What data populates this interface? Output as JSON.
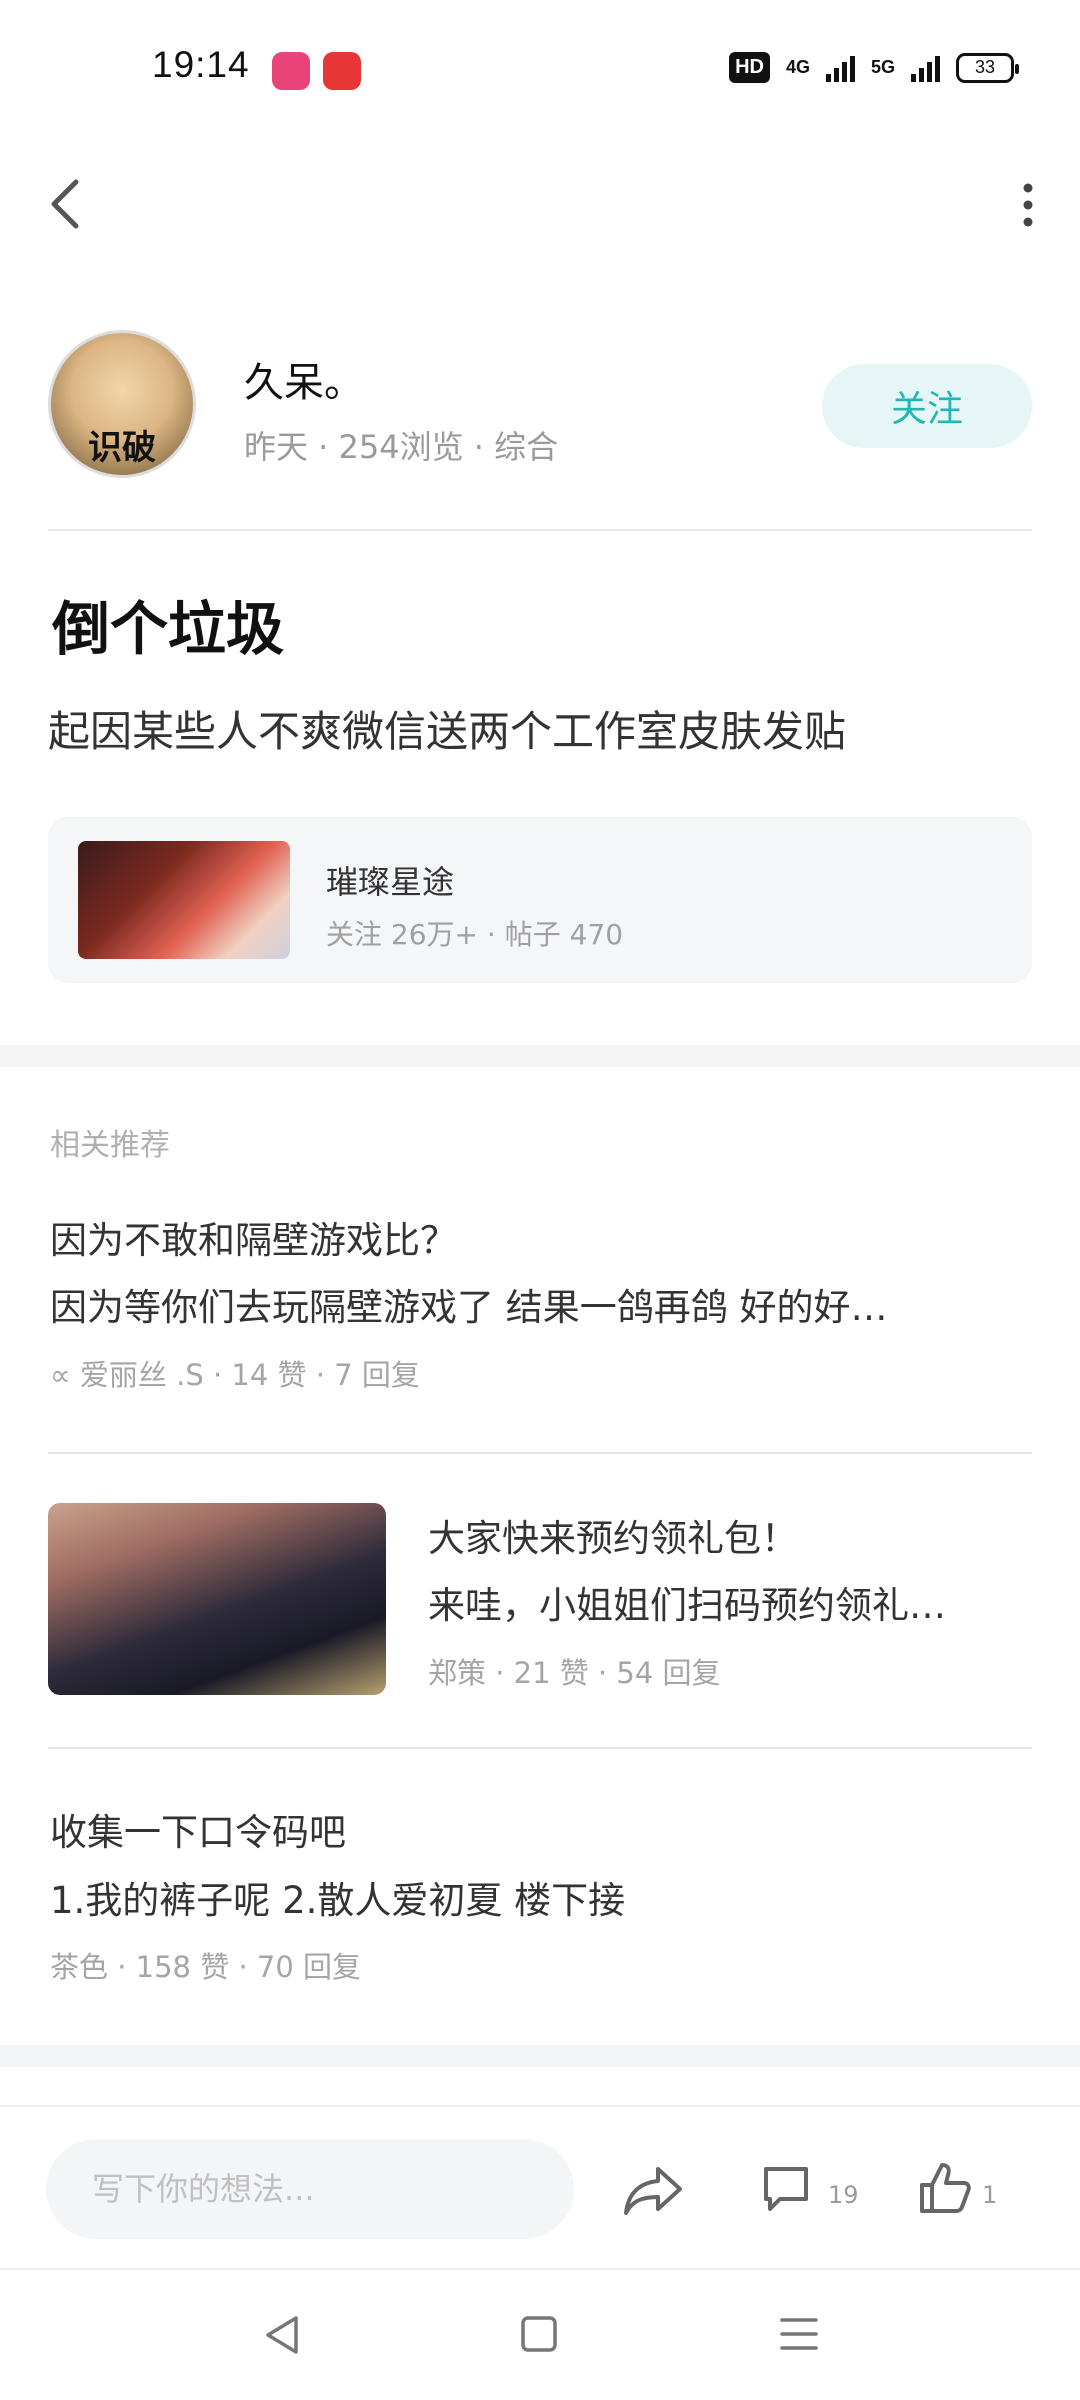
{
  "status_bar": {
    "time": "19:14",
    "hd_label": "HD",
    "net_4g": "4G",
    "net_5g": "5G",
    "battery": "33"
  },
  "author": {
    "avatar_text": "识破",
    "name": "久呆。",
    "meta": "昨天 · 254浏览 · 综合",
    "follow_label": "关注"
  },
  "post": {
    "title": "倒个垃圾",
    "body": "起因某些人不爽微信送两个工作室皮肤发贴"
  },
  "topic": {
    "name": "璀璨星途",
    "meta": "关注 26万+ · 帖子 470"
  },
  "related": {
    "header": "相关推荐",
    "items": [
      {
        "title": "因为不敢和隔壁游戏比？",
        "excerpt": "因为等你们去玩隔壁游戏了 结果一鸽再鸽 好的好…",
        "meta": "∝  爱丽丝 .S · 14 赞 · 7 回复"
      },
      {
        "title": "大家快来预约领礼包！",
        "excerpt": "来哇，小姐姐们扫码预约领礼…",
        "meta": "郑策 · 21 赞 · 54 回复"
      },
      {
        "title": "收集一下口令码吧",
        "excerpt": "1.我的裤子呢 2.散人爱初夏 楼下接",
        "meta": "茶色 · 158 赞 · 70 回复"
      }
    ]
  },
  "actions": {
    "comment_placeholder": "写下你的想法...",
    "comment_count": "19",
    "like_count": "1"
  },
  "colors": {
    "accent": "#1fb8b6",
    "follow_bg": "#e6f6f6",
    "muted_text": "#a5a5a5"
  },
  "icons": [
    "back-icon",
    "more-icon",
    "share-icon",
    "comment-icon",
    "like-icon",
    "nav-back-icon",
    "nav-home-icon",
    "nav-menu-icon"
  ]
}
